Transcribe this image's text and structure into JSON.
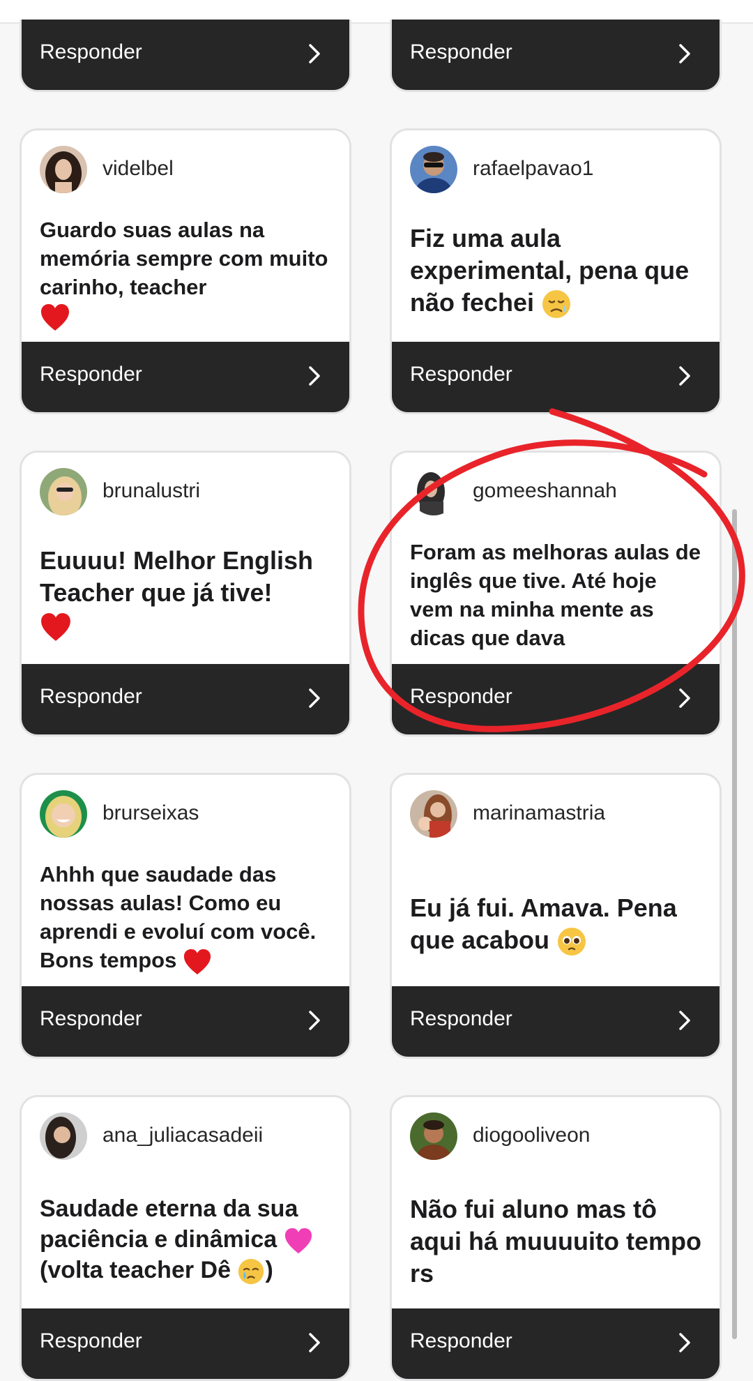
{
  "responder_label": "Responder",
  "annotation_color": "#e8242a",
  "cards": [
    {
      "username": "",
      "comment": ""
    },
    {
      "username": "",
      "comment": ""
    },
    {
      "username": "videlbel",
      "comment": "Guardo suas aulas na memória sempre com muito carinho, teacher",
      "emoji": "heart-icon"
    },
    {
      "username": "rafaelpavao1",
      "comment": "Fiz uma aula experimental,  pena que não fechei",
      "emoji": "sad-sweat-face-icon"
    },
    {
      "username": "brunalustri",
      "comment": "Euuuu! Melhor English Teacher que já tive!",
      "emoji": "heart-icon"
    },
    {
      "username": "gomeeshannah",
      "comment": "Foram as melhoras aulas de inglês que tive. Até hoje vem na minha mente as dicas que dava"
    },
    {
      "username": "brurseixas",
      "comment": "Ahhh que saudade das nossas aulas! Como eu aprendi e evoluí com você. Bons tempos",
      "emoji": "heart-icon"
    },
    {
      "username": "marinamastria",
      "comment": "Eu já fui. Amava. Pena que acabou",
      "emoji": "pleading-face-icon"
    },
    {
      "username": "ana_juliacasadeii",
      "comment_line1": "Saudade eterna da sua",
      "comment_line2": "paciência e dinâmica",
      "comment_line3a": "(volta teacher Dê",
      "comment_line3b": ")",
      "emoji": "pink-heart-icon",
      "emoji2": "crying-face-icon"
    },
    {
      "username": "diogooliveon",
      "comment": "Não fui aluno mas tô aqui há muuuuito tempo rs"
    }
  ]
}
